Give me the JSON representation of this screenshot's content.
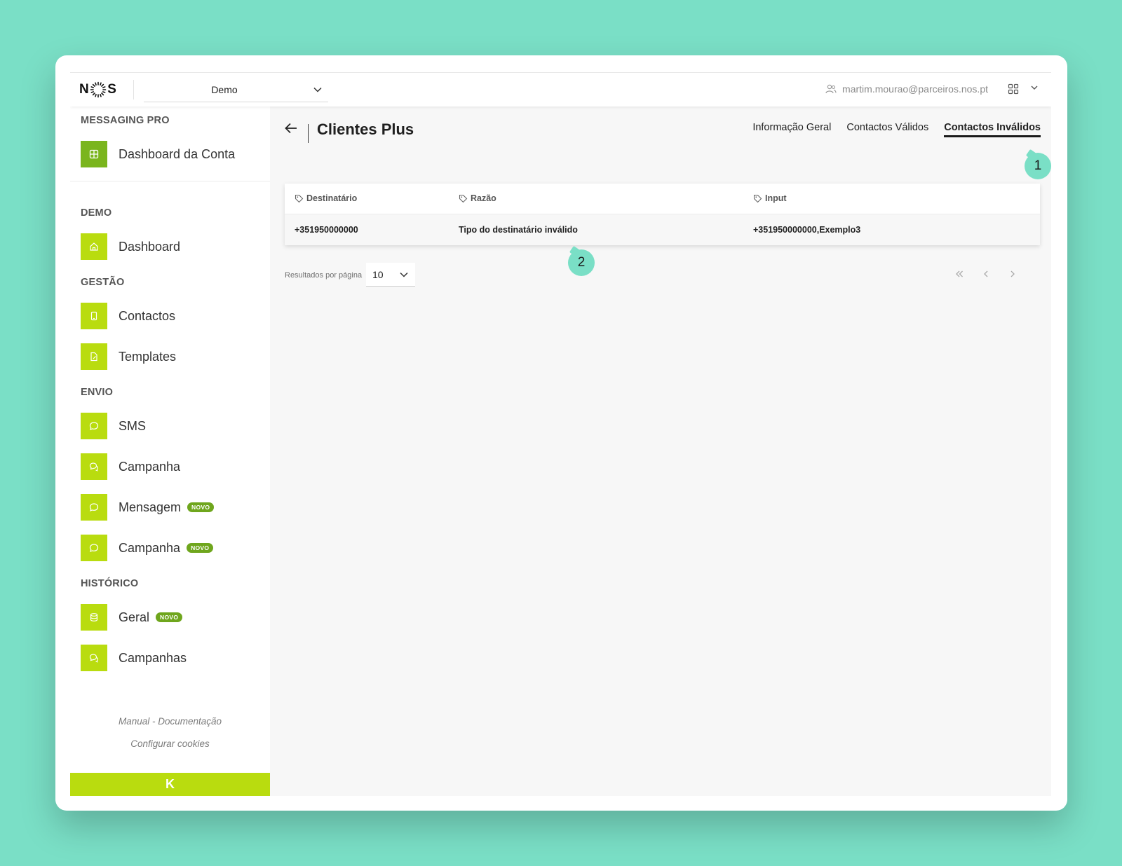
{
  "header": {
    "account_selected": "Demo",
    "user_email": "martim.mourao@parceiros.nos.pt"
  },
  "sidebar": {
    "sections": {
      "messaging_pro": "MESSAGING PRO",
      "demo": "DEMO",
      "gestao": "GESTÃO",
      "envio": "ENVIO",
      "historico": "HISTÓRICO"
    },
    "items": {
      "dashboard_conta": "Dashboard da Conta",
      "dashboard": "Dashboard",
      "contactos": "Contactos",
      "templates": "Templates",
      "sms": "SMS",
      "campanha": "Campanha",
      "mensagem": "Mensagem",
      "campanha_novo": "Campanha",
      "geral": "Geral",
      "campanhas": "Campanhas"
    },
    "badge_new": "NOVO",
    "links": {
      "manual": "Manual - Documentação",
      "cookies": "Configurar cookies"
    },
    "collapse_glyph": "K"
  },
  "main": {
    "title": "Clientes Plus",
    "tabs": [
      {
        "label": "Informação Geral",
        "active": false
      },
      {
        "label": "Contactos Válidos",
        "active": false
      },
      {
        "label": "Contactos Inválidos",
        "active": true
      }
    ],
    "table": {
      "columns": [
        "Destinatário",
        "Razão",
        "Input"
      ],
      "rows": [
        [
          "+351950000000",
          "Tipo do destinatário inválido",
          "+351950000000,Exemplo3"
        ]
      ]
    },
    "pagination": {
      "per_page_label": "Resultados por página",
      "per_page_value": "10"
    }
  },
  "callouts": [
    "1",
    "2"
  ],
  "colors": {
    "background": "#7adfc6",
    "brand_green": "#b9dc0f",
    "badge_green": "#6fa61d"
  }
}
